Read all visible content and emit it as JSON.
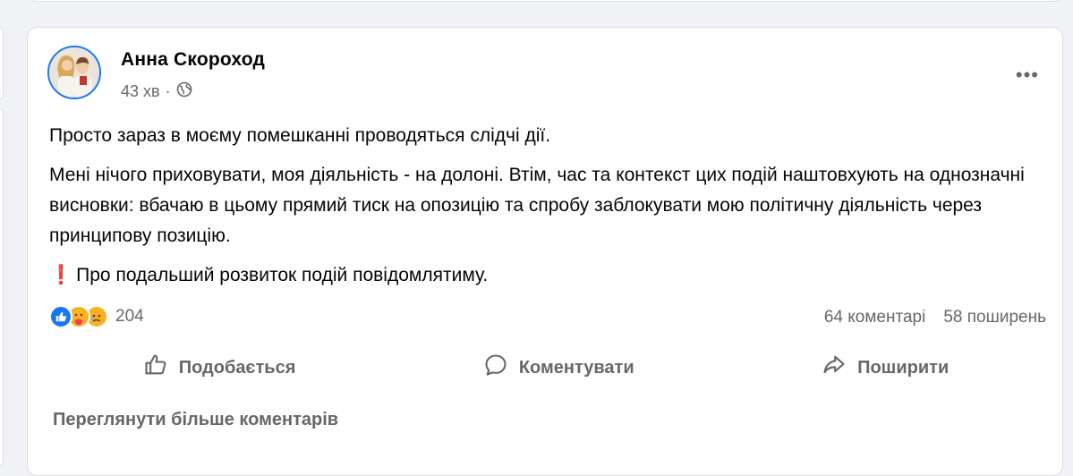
{
  "post": {
    "author": "Анна Скороход",
    "time": "43 хв",
    "separator": "·",
    "paragraphs": {
      "p1": "Просто зараз в моєму помешканні проводяться слідчі дії.",
      "p2": "Мені нічого приховувати, моя діяльність - на долоні. Втім, час та контекст цих подій наштовхують на однозначні висновки: вбачаю в цьому прямий тиск на опозицію та спробу заблокувати мою політичну діяльність через принципову позицію.",
      "p3": "Про подальший розвиток подій повідомлятиму."
    },
    "exclamation": "❗"
  },
  "engagement": {
    "reaction_count": "204",
    "comments": "64 коментарі",
    "shares": "58 поширень",
    "reaction_icons": [
      "like-icon",
      "care-icon",
      "sad-icon"
    ]
  },
  "actions": {
    "like": "Подобається",
    "comment": "Коментувати",
    "share": "Поширити"
  },
  "more_comments": "Переглянути більше коментарів",
  "colors": {
    "accent": "#1877f2",
    "secondary_text": "#65676b",
    "background": "#f0f2f5"
  }
}
